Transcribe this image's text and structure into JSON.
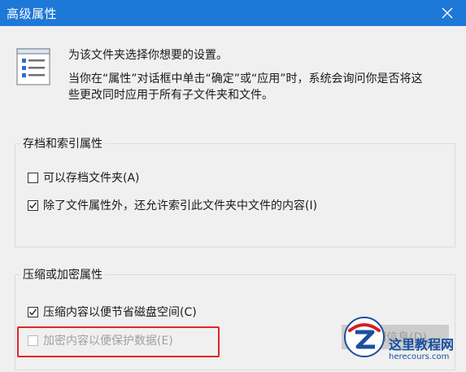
{
  "window": {
    "title": "高级属性"
  },
  "intro": {
    "line1": "为该文件夹选择你想要的设置。",
    "line2": "当你在“属性”对话框中单击“确定”或“应用”时，系统会询问你是否将这",
    "line3": "些更改同时应用于所有子文件夹和文件。"
  },
  "archive_group": {
    "label": "存档和索引属性",
    "options": [
      {
        "label": "可以存档文件夹(A)",
        "checked": false
      },
      {
        "label": "除了文件属性外，还允许索引此文件夹中文件的内容(I)",
        "checked": true
      }
    ]
  },
  "compress_group": {
    "label": "压缩或加密属性",
    "options": [
      {
        "label": "压缩内容以便节省磁盘空间(C)",
        "checked": true
      },
      {
        "label": "加密内容以便保护数据(E)",
        "checked": false,
        "disabled": true
      }
    ],
    "details_button": "详细信息(D)"
  },
  "watermark": {
    "name": "这里教程网",
    "url": "herecours.com"
  },
  "colors": {
    "titlebar": "#1e78d7",
    "highlight": "#e02525",
    "watermark_blue": "#1a4fa0",
    "watermark_red": "#d42020"
  }
}
